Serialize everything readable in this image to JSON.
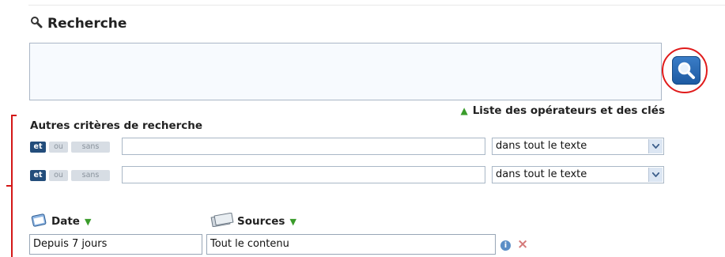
{
  "header": {
    "title": "Recherche",
    "icon": "magnifier-icon"
  },
  "search": {
    "main_value": "",
    "button_icon": "search-icon",
    "highlight_color": "#e01b1b"
  },
  "operators_link": {
    "label": "Liste des opérateurs et des clés",
    "icon": "expand-up-icon"
  },
  "criteria": {
    "title": "Autres critères de recherche",
    "rows": [
      {
        "chips": [
          {
            "label": "et",
            "active": true
          },
          {
            "label": "ou",
            "active": false
          },
          {
            "label": "sans",
            "active": false
          }
        ],
        "value": "",
        "scope": "dans tout le texte"
      },
      {
        "chips": [
          {
            "label": "et",
            "active": true
          },
          {
            "label": "ou",
            "active": false
          },
          {
            "label": "sans",
            "active": false
          }
        ],
        "value": "",
        "scope": "dans tout le texte"
      }
    ]
  },
  "date": {
    "label": "Date",
    "icon": "calendar-icon",
    "value": "Depuis 7 jours"
  },
  "sources": {
    "label": "Sources",
    "icon": "newspaper-icon",
    "value": "Tout le contenu"
  },
  "colors": {
    "chip_active": "#234d7b",
    "accent_green": "#3a9c2b",
    "button_blue": "#2f6fb9"
  }
}
